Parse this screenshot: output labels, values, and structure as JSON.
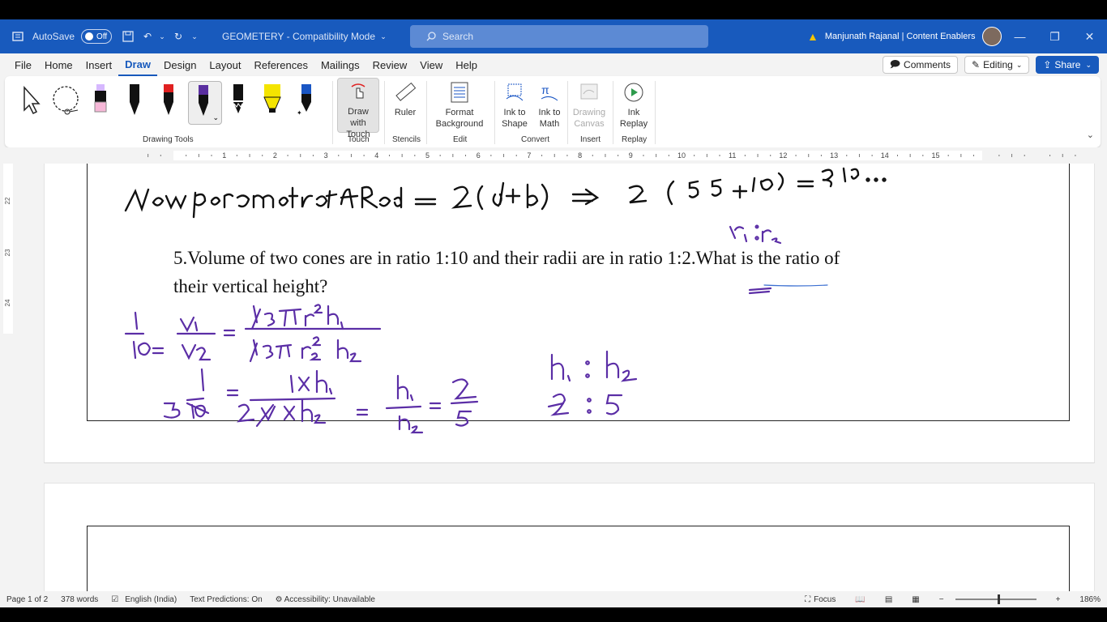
{
  "titlebar": {
    "autosave_label": "AutoSave",
    "autosave_state": "Off",
    "doc_title": "GEOMETERY  -  Compatibility Mode",
    "search_placeholder": "Search",
    "user_name": "Manjunath Rajanal | Content Enablers"
  },
  "tabs": [
    "File",
    "Home",
    "Insert",
    "Draw",
    "Design",
    "Layout",
    "References",
    "Mailings",
    "Review",
    "View",
    "Help"
  ],
  "active_tab": "Draw",
  "tab_actions": {
    "comments": "Comments",
    "editing": "Editing",
    "share": "Share"
  },
  "ribbon": {
    "groups": {
      "drawing_tools": "Drawing Tools",
      "touch": "Touch",
      "stencils": "Stencils",
      "edit": "Edit",
      "convert": "Convert",
      "insert": "Insert",
      "replay": "Replay"
    },
    "buttons": {
      "draw_with_touch": "Draw with Touch",
      "ruler": "Ruler",
      "format_background": "Format Background",
      "ink_to_shape": "Ink to Shape",
      "ink_to_math": "Ink to Math",
      "drawing_canvas": "Drawing Canvas",
      "ink_replay": "Ink Replay"
    },
    "pen_colors": [
      "#f7d8e8",
      "#000000",
      "#e02020",
      "#5a2fa0",
      "#000000",
      "#f4e400",
      "#1a56c4"
    ]
  },
  "ruler_numbers": [
    "1",
    "2",
    "3",
    "4",
    "5",
    "6",
    "7",
    "8",
    "9",
    "10",
    "11",
    "12",
    "13",
    "14",
    "15"
  ],
  "vruler_numbers": [
    "22",
    "23",
    "24"
  ],
  "document": {
    "question_line1": "5.Volume of two cones are in ratio 1:10 and their radii are in ratio 1:2.What is the ratio of",
    "question_line2": "their vertical height?",
    "ink_color": "#5b2ea6"
  },
  "status": {
    "page": "Page 1 of 2",
    "words": "378 words",
    "language": "English (India)",
    "predictions": "Text Predictions: On",
    "accessibility": "Accessibility: Unavailable",
    "focus": "Focus",
    "zoom": "186%"
  }
}
